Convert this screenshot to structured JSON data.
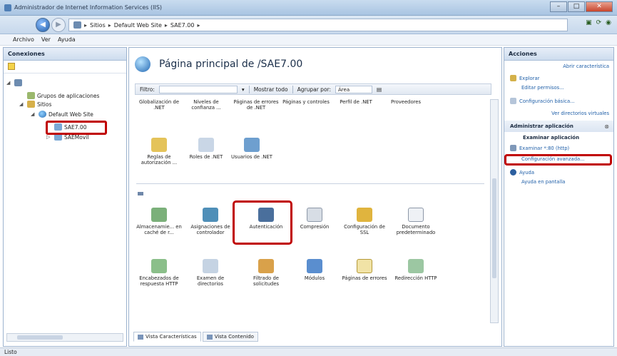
{
  "window": {
    "title": "Administrador de Internet Information Services (IIS)"
  },
  "address": {
    "crumbs": [
      "Sitios",
      "Default Web Site",
      "SAE7.00"
    ]
  },
  "menu": {
    "items": [
      "Archivo",
      "Ver",
      "Ayuda"
    ]
  },
  "connections": {
    "title": "Conexiones",
    "tree": [
      "",
      "Grupos de aplicaciones",
      "Sitios",
      "Default Web Site",
      "SAE7.00",
      "SAEMovil"
    ]
  },
  "main": {
    "title": "Página principal de /SAE7.00",
    "filter": {
      "label": "Filtro:",
      "show_all": "Mostrar todo",
      "group_by_label": "Agrupar por:",
      "group_by_value": "Área"
    },
    "row1": [
      "Globalización de .NET",
      "Niveles de confianza ...",
      "Páginas de errores de .NET",
      "Páginas y controles",
      "Perfil de .NET",
      "Proveedores"
    ],
    "row2": [
      "Reglas de autorización ...",
      "Roles de .NET",
      "Usuarios de .NET"
    ],
    "row3": [
      "Almacenamie... en caché de r...",
      "Asignaciones de controlador",
      "Autenticación",
      "Compresión",
      "Configuración de SSL",
      "Documento predeterminado"
    ],
    "row4": [
      "Encabezados de respuesta HTTP",
      "Examen de directorios",
      "Filtrado de solicitudes",
      "Módulos",
      "Páginas de errores",
      "Redirección HTTP"
    ],
    "tabs": {
      "features": "Vista Características",
      "content": "Vista Contenido"
    }
  },
  "actions": {
    "title": "Acciones",
    "add_feature": "Abrir característica",
    "explore": "Explorar",
    "edit_permissions": "Editar permisos...",
    "basic_settings": "Configuración básica...",
    "virtual_dirs": "Ver directorios virtuales",
    "manage_app": "Administrar aplicación",
    "browse_app": "Examinar aplicación",
    "browse_link": "Examinar *:80 (http)",
    "advanced_settings": "Configuración avanzada...",
    "help": "Ayuda",
    "online_help": "Ayuda en pantalla"
  },
  "status": {
    "text": "Listo"
  }
}
